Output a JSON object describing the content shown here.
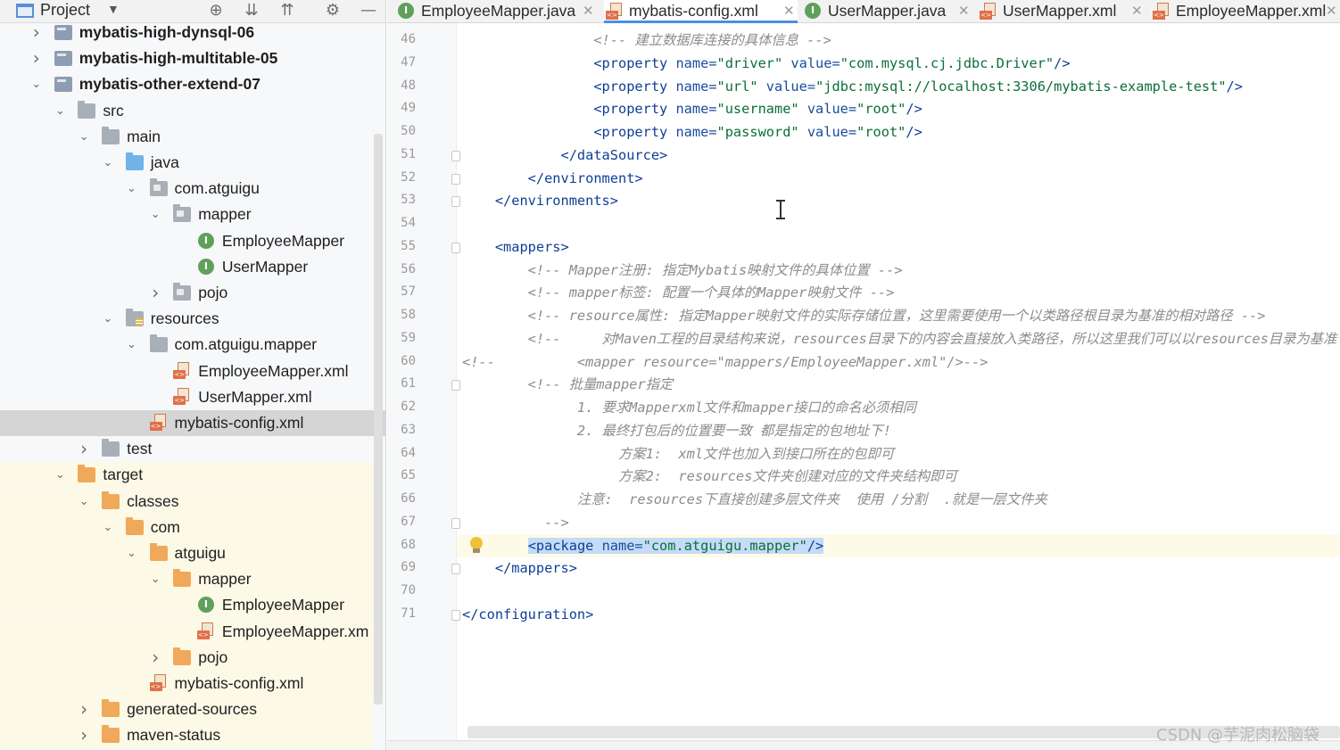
{
  "project_panel": {
    "title": "Project",
    "tools": [
      "locate-icon",
      "expand-all-icon",
      "collapse-all-icon",
      "gear-icon",
      "hide-icon"
    ],
    "tree": [
      {
        "label": "mybatis-high-dynsql-06",
        "icon": "module",
        "expanded": false,
        "bold": true
      },
      {
        "label": "mybatis-high-multitable-05",
        "icon": "module",
        "expanded": false,
        "bold": true
      },
      {
        "label": "mybatis-other-extend-07",
        "icon": "module",
        "expanded": true,
        "bold": true
      },
      {
        "label": "src",
        "icon": "folder",
        "expanded": true
      },
      {
        "label": "main",
        "icon": "folder",
        "expanded": true
      },
      {
        "label": "java",
        "icon": "source-folder",
        "expanded": true
      },
      {
        "label": "com.atguigu",
        "icon": "package",
        "expanded": true
      },
      {
        "label": "mapper",
        "icon": "package",
        "expanded": true
      },
      {
        "label": "EmployeeMapper",
        "icon": "interface"
      },
      {
        "label": "UserMapper",
        "icon": "interface"
      },
      {
        "label": "pojo",
        "icon": "package",
        "expanded": false
      },
      {
        "label": "resources",
        "icon": "resources-folder",
        "expanded": true
      },
      {
        "label": "com.atguigu.mapper",
        "icon": "folder",
        "expanded": true
      },
      {
        "label": "EmployeeMapper.xml",
        "icon": "xml"
      },
      {
        "label": "UserMapper.xml",
        "icon": "xml"
      },
      {
        "label": "mybatis-config.xml",
        "icon": "xml",
        "selected": true
      },
      {
        "label": "test",
        "icon": "folder",
        "expanded": false
      },
      {
        "label": "target",
        "icon": "excluded-folder",
        "expanded": true
      },
      {
        "label": "classes",
        "icon": "excluded-folder",
        "expanded": true
      },
      {
        "label": "com",
        "icon": "excluded-folder",
        "expanded": true
      },
      {
        "label": "atguigu",
        "icon": "excluded-folder",
        "expanded": true
      },
      {
        "label": "mapper",
        "icon": "excluded-folder",
        "expanded": true
      },
      {
        "label": "EmployeeMapper",
        "icon": "interface"
      },
      {
        "label": "EmployeeMapper.xm",
        "icon": "xml"
      },
      {
        "label": "pojo",
        "icon": "excluded-folder",
        "expanded": false
      },
      {
        "label": "mybatis-config.xml",
        "icon": "xml"
      },
      {
        "label": "generated-sources",
        "icon": "excluded-folder",
        "expanded": false
      },
      {
        "label": "maven-status",
        "icon": "excluded-folder",
        "expanded": false
      }
    ]
  },
  "tabs": [
    {
      "label": "EmployeeMapper.java",
      "icon": "interface",
      "active": false
    },
    {
      "label": "mybatis-config.xml",
      "icon": "xml",
      "active": true
    },
    {
      "label": "UserMapper.java",
      "icon": "interface",
      "active": false
    },
    {
      "label": "UserMapper.xml",
      "icon": "xml",
      "active": false
    },
    {
      "label": "EmployeeMapper.xml",
      "icon": "xml",
      "active": false
    }
  ],
  "editor": {
    "current_line": 68,
    "lines": [
      {
        "n": "46",
        "segs": [
          [
            "c",
            "                <!-- 建立数据库连接的具体信息 -->"
          ]
        ]
      },
      {
        "n": "47",
        "segs": [
          [
            "t",
            "                <property "
          ],
          [
            "a",
            "name="
          ],
          [
            "v",
            "\"driver\""
          ],
          [
            "t",
            " "
          ],
          [
            "a",
            "value="
          ],
          [
            "v",
            "\"com.mysql.cj.jdbc.Driver\""
          ],
          [
            "t",
            "/>"
          ]
        ]
      },
      {
        "n": "48",
        "segs": [
          [
            "t",
            "                <property "
          ],
          [
            "a",
            "name="
          ],
          [
            "v",
            "\"url\""
          ],
          [
            "t",
            " "
          ],
          [
            "a",
            "value="
          ],
          [
            "v",
            "\"jdbc:mysql://localhost:3306/mybatis-example-test\""
          ],
          [
            "t",
            "/>"
          ]
        ]
      },
      {
        "n": "49",
        "segs": [
          [
            "t",
            "                <property "
          ],
          [
            "a",
            "name="
          ],
          [
            "v",
            "\"username\""
          ],
          [
            "t",
            " "
          ],
          [
            "a",
            "value="
          ],
          [
            "v",
            "\"root\""
          ],
          [
            "t",
            "/>"
          ]
        ]
      },
      {
        "n": "50",
        "segs": [
          [
            "t",
            "                <property "
          ],
          [
            "a",
            "name="
          ],
          [
            "v",
            "\"password\""
          ],
          [
            "t",
            " "
          ],
          [
            "a",
            "value="
          ],
          [
            "v",
            "\"root\""
          ],
          [
            "t",
            "/>"
          ]
        ]
      },
      {
        "n": "51",
        "segs": [
          [
            "t",
            "            </dataSource>"
          ]
        ]
      },
      {
        "n": "52",
        "segs": [
          [
            "t",
            "        </environment>"
          ]
        ]
      },
      {
        "n": "53",
        "segs": [
          [
            "t",
            "    </environments>"
          ]
        ]
      },
      {
        "n": "54",
        "segs": [
          [
            "t",
            ""
          ]
        ]
      },
      {
        "n": "55",
        "segs": [
          [
            "t",
            "    <mappers>"
          ]
        ]
      },
      {
        "n": "56",
        "segs": [
          [
            "c",
            "        <!-- Mapper注册: 指定Mybatis映射文件的具体位置 -->"
          ]
        ]
      },
      {
        "n": "57",
        "segs": [
          [
            "c",
            "        <!-- mapper标签: 配置一个具体的Mapper映射文件 -->"
          ]
        ]
      },
      {
        "n": "58",
        "segs": [
          [
            "c",
            "        <!-- resource属性: 指定Mapper映射文件的实际存储位置，这里需要使用一个以类路径根目录为基准的相对路径 -->"
          ]
        ]
      },
      {
        "n": "59",
        "segs": [
          [
            "c",
            "        <!--     对Maven工程的目录结构来说，resources目录下的内容会直接放入类路径，所以这里我们可以以resources目录为基准 -->"
          ]
        ]
      },
      {
        "n": "60",
        "segs": [
          [
            "c",
            "<!--          <mapper resource=\"mappers/EmployeeMapper.xml\"/>-->"
          ]
        ]
      },
      {
        "n": "61",
        "segs": [
          [
            "c",
            "        <!-- 批量mapper指定"
          ]
        ]
      },
      {
        "n": "62",
        "segs": [
          [
            "c",
            "              1. 要求Mapperxml文件和mapper接口的命名必须相同"
          ]
        ]
      },
      {
        "n": "63",
        "segs": [
          [
            "c",
            "              2. 最终打包后的位置要一致 都是指定的包地址下!"
          ]
        ]
      },
      {
        "n": "64",
        "segs": [
          [
            "c",
            "                   方案1:  xml文件也加入到接口所在的包即可"
          ]
        ]
      },
      {
        "n": "65",
        "segs": [
          [
            "c",
            "                   方案2:  resources文件夹创建对应的文件夹结构即可"
          ]
        ]
      },
      {
        "n": "66",
        "segs": [
          [
            "c",
            "              注意:  resources下直接创建多层文件夹  使用 /分割  .就是一层文件夹"
          ]
        ]
      },
      {
        "n": "67",
        "segs": [
          [
            "c",
            "          -->"
          ]
        ]
      },
      {
        "n": "68",
        "segs": [
          [
            "t",
            "        "
          ],
          [
            "h",
            "<package "
          ],
          [
            "ha",
            "name="
          ],
          [
            "hv",
            "\"com.atguigu.mapper\""
          ],
          [
            "h",
            "/>"
          ]
        ]
      },
      {
        "n": "69",
        "segs": [
          [
            "t",
            "    </mappers>"
          ]
        ]
      },
      {
        "n": "70",
        "segs": [
          [
            "t",
            ""
          ]
        ]
      },
      {
        "n": "71",
        "segs": [
          [
            "t",
            "</configuration>"
          ]
        ]
      }
    ]
  },
  "watermark": "CSDN @芋泥肉松脑袋"
}
